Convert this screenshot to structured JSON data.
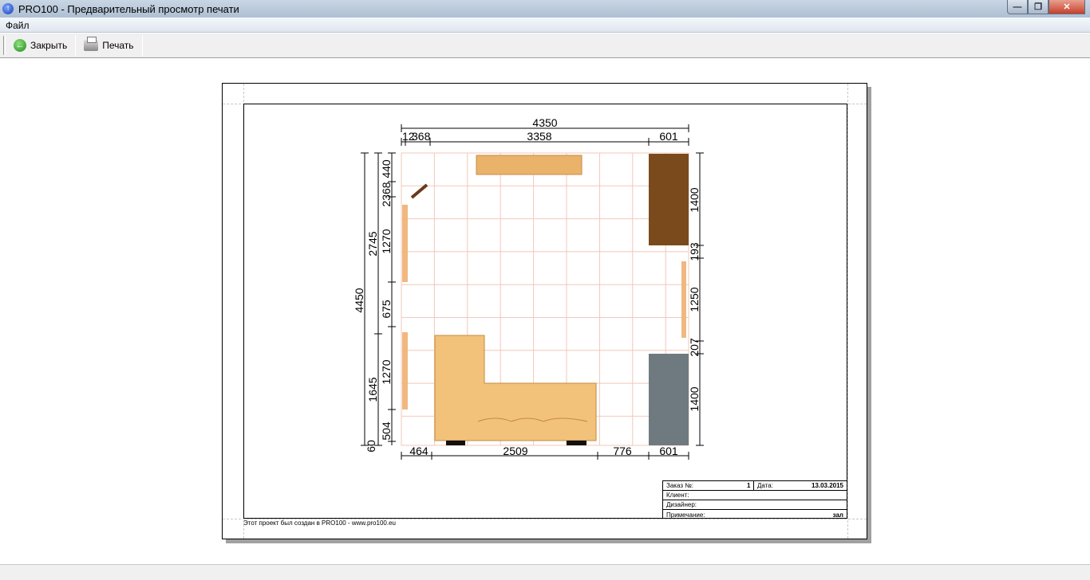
{
  "window": {
    "title": "PRO100 - Предварительный просмотр печати",
    "min": "—",
    "restore": "❐",
    "close": "✕"
  },
  "menu": {
    "file": "Файл"
  },
  "toolbar": {
    "close_label": "Закрыть",
    "print_label": "Печать"
  },
  "drawing": {
    "top_total": "4350",
    "top_parts": [
      "12",
      "368",
      "3358",
      "601"
    ],
    "left_total": "4450",
    "left_mid": [
      "2745",
      "1645"
    ],
    "left_parts": [
      "440",
      "2368",
      "1270",
      "675",
      "1270",
      "504",
      "60"
    ],
    "right_parts": [
      "1400",
      "193",
      "1250",
      "207",
      "1400"
    ],
    "bottom_parts": [
      "464",
      "2509",
      "776",
      "601"
    ]
  },
  "stamp": {
    "order_label": "Заказ №:",
    "order_value": "1",
    "date_label": "Дата:",
    "date_value": "13.03.2015",
    "client_label": "Клиент:",
    "designer_label": "Дизайнер:",
    "note_label": "Примечание:",
    "note_value": "зал"
  },
  "footer": "Этот проект был создан в PRO100 - www.pro100.eu",
  "colors": {
    "grid": "#f2c8b8",
    "sofa": "#f2c27a",
    "wood_light": "#e9b36a",
    "wood_dark": "#7a4a1c",
    "stone": "#6f7a80"
  }
}
